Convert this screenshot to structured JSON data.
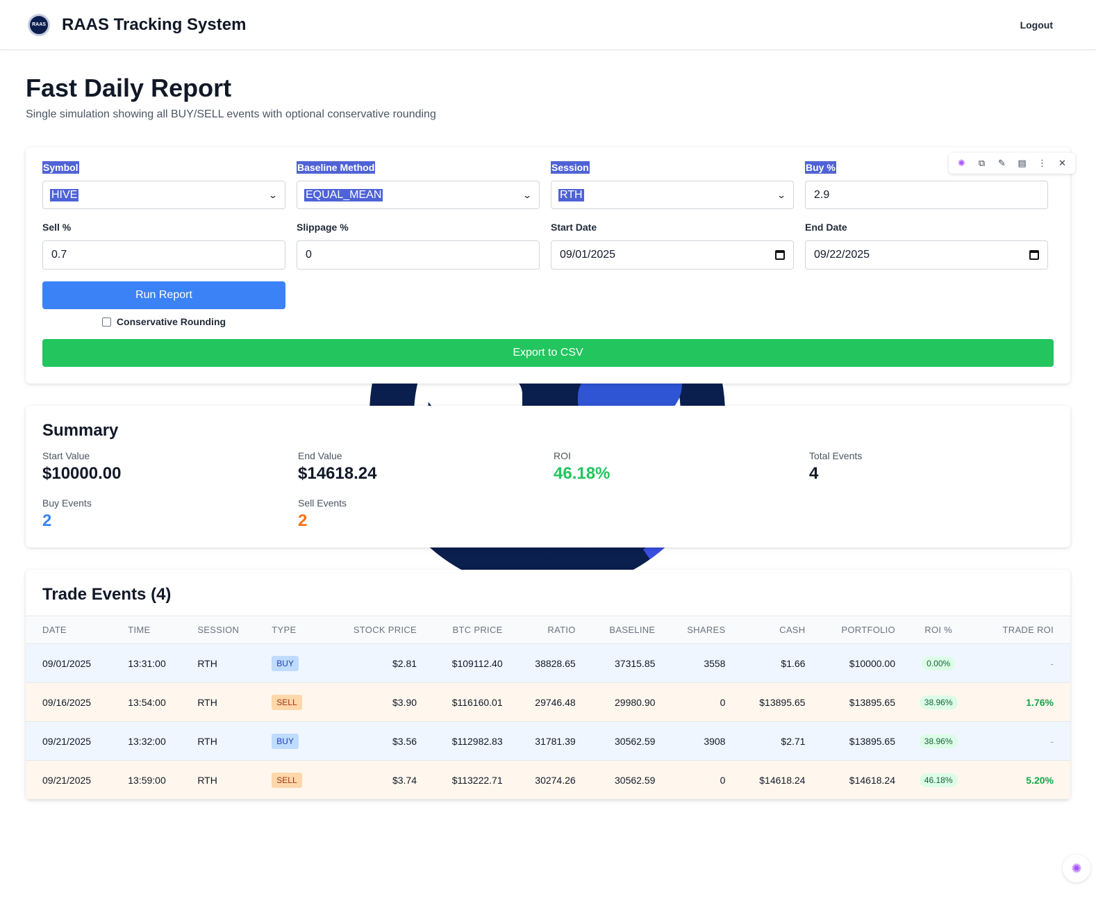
{
  "header": {
    "logo_text": "RAAS",
    "app_title": "RAAS Tracking System",
    "logout_label": "Logout"
  },
  "page": {
    "title": "Fast Daily Report",
    "subtitle": "Single simulation showing all BUY/SELL events with optional conservative rounding"
  },
  "form": {
    "symbol": {
      "label": "Symbol",
      "value": "HIVE"
    },
    "baseline": {
      "label": "Baseline Method",
      "value": "EQUAL_MEAN"
    },
    "session": {
      "label": "Session",
      "value": "RTH"
    },
    "buy": {
      "label": "Buy %",
      "value": "2.9"
    },
    "sell": {
      "label": "Sell %",
      "value": "0.7"
    },
    "slippage": {
      "label": "Slippage %",
      "value": "0"
    },
    "start_date": {
      "label": "Start Date",
      "value": "09/01/2025"
    },
    "end_date": {
      "label": "End Date",
      "value": "09/22/2025"
    },
    "run_label": "Run Report",
    "conservative_label": "Conservative Rounding",
    "export_label": "Export to CSV"
  },
  "summary": {
    "title": "Summary",
    "start_value": {
      "label": "Start Value",
      "value": "$10000.00"
    },
    "end_value": {
      "label": "End Value",
      "value": "$14618.24"
    },
    "roi": {
      "label": "ROI",
      "value": "46.18%"
    },
    "total_events": {
      "label": "Total Events",
      "value": "4"
    },
    "buy_events": {
      "label": "Buy Events",
      "value": "2"
    },
    "sell_events": {
      "label": "Sell Events",
      "value": "2"
    }
  },
  "trades": {
    "title": "Trade Events (4)",
    "headers": [
      "Date",
      "Time",
      "Session",
      "Type",
      "Stock Price",
      "BTC Price",
      "Ratio",
      "Baseline",
      "Shares",
      "Cash",
      "Portfolio",
      "ROI %",
      "Trade ROI"
    ],
    "rows": [
      [
        "09/01/2025",
        "13:31:00",
        "RTH",
        "BUY",
        "$2.81",
        "$109112.40",
        "38828.65",
        "37315.85",
        "3558",
        "$1.66",
        "$10000.00",
        "0.00%",
        "-"
      ],
      [
        "09/16/2025",
        "13:54:00",
        "RTH",
        "SELL",
        "$3.90",
        "$116160.01",
        "29746.48",
        "29980.90",
        "0",
        "$13895.65",
        "$13895.65",
        "38.96%",
        "1.76%"
      ],
      [
        "09/21/2025",
        "13:32:00",
        "RTH",
        "BUY",
        "$3.56",
        "$112982.83",
        "31781.39",
        "30562.59",
        "3908",
        "$2.71",
        "$13895.65",
        "38.96%",
        "-"
      ],
      [
        "09/21/2025",
        "13:59:00",
        "RTH",
        "SELL",
        "$3.74",
        "$113222.71",
        "30274.26",
        "30562.59",
        "0",
        "$14618.24",
        "$14618.24",
        "46.18%",
        "5.20%"
      ]
    ]
  },
  "icons": {
    "toolbar": [
      "brain-icon",
      "copy-icon",
      "pen-icon",
      "note-icon",
      "more-icon",
      "close-icon"
    ],
    "fab": "brain-icon"
  },
  "colors": {
    "primary": "#3b82f6",
    "success": "#22c55e",
    "sell": "#f97316",
    "selection": "#4f62d6"
  }
}
